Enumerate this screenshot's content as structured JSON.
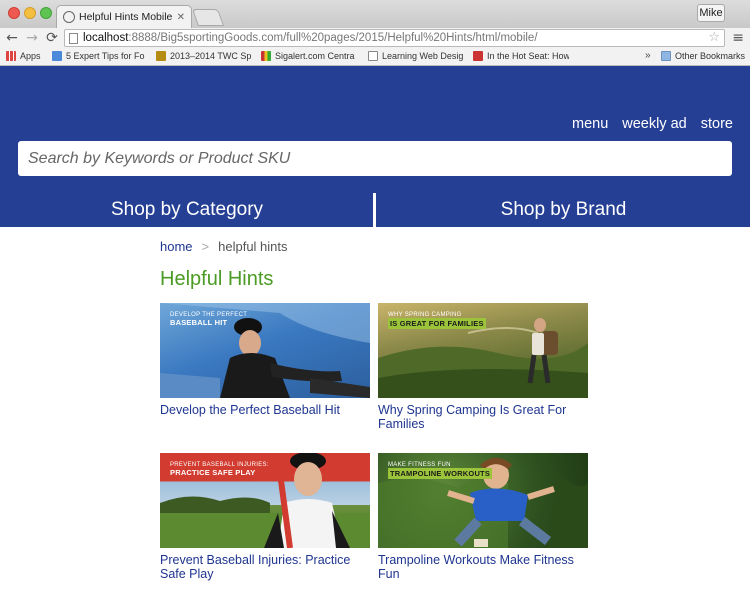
{
  "browser": {
    "tab_title": "Helpful Hints Mobile Land",
    "tab_close": "✕",
    "user_name": "Mike",
    "url_host": "localhost",
    "url_rest": ":8888/Big5sportingGoods.com/full%20pages/2015/Helpful%20Hints/html/mobile/",
    "back_icon": "←",
    "forward_icon": "→",
    "reload_icon": "⟳",
    "star_icon": "☆",
    "menu_icon": "≡",
    "bookmarks": [
      {
        "label": "Apps",
        "color": "#d44"
      },
      {
        "label": "5 Expert Tips for Fo",
        "color": "#4a8ad8"
      },
      {
        "label": "2013–2014 TWC Sp",
        "color": "#b58b12"
      },
      {
        "label": "Sigalert.com Centra",
        "color": "#c33"
      },
      {
        "label": "Learning Web Desig",
        "color": "#ffffff"
      },
      {
        "label": "In the Hot Seat: How",
        "color": "#c33"
      }
    ],
    "bookmarks_more": "»",
    "other_bookmarks": "Other Bookmarks"
  },
  "header": {
    "links": [
      "menu",
      "weekly ad",
      "store"
    ],
    "search_placeholder": "Search by Keywords or Product SKU",
    "shop_by_category": "Shop by Category",
    "shop_by_brand": "Shop by Brand",
    "brand_color": "#253f95"
  },
  "breadcrumb": {
    "home": "home",
    "separator": ">",
    "current": "helpful hints"
  },
  "page": {
    "title": "Helpful Hints",
    "title_color": "#4b9b24"
  },
  "articles": [
    {
      "tag_line1": "DEVELOP THE PERFECT",
      "tag_line2": "BASEBALL HIT",
      "caption": "Develop the Perfect Baseball Hit"
    },
    {
      "tag_line1": "WHY SPRING CAMPING",
      "tag_line2": "IS GREAT FOR FAMILIES",
      "caption": "Why Spring Camping Is Great For Families"
    },
    {
      "tag_line1": "PREVENT BASEBALL INJURIES:",
      "tag_line2": "PRACTICE SAFE PLAY",
      "caption": "Prevent Baseball Injuries: Practice Safe Play"
    },
    {
      "tag_line1": "MAKE FITNESS FUN",
      "tag_line2": "TRAMPOLINE WORKOUTS",
      "caption": "Trampoline Workouts Make Fitness Fun"
    }
  ]
}
